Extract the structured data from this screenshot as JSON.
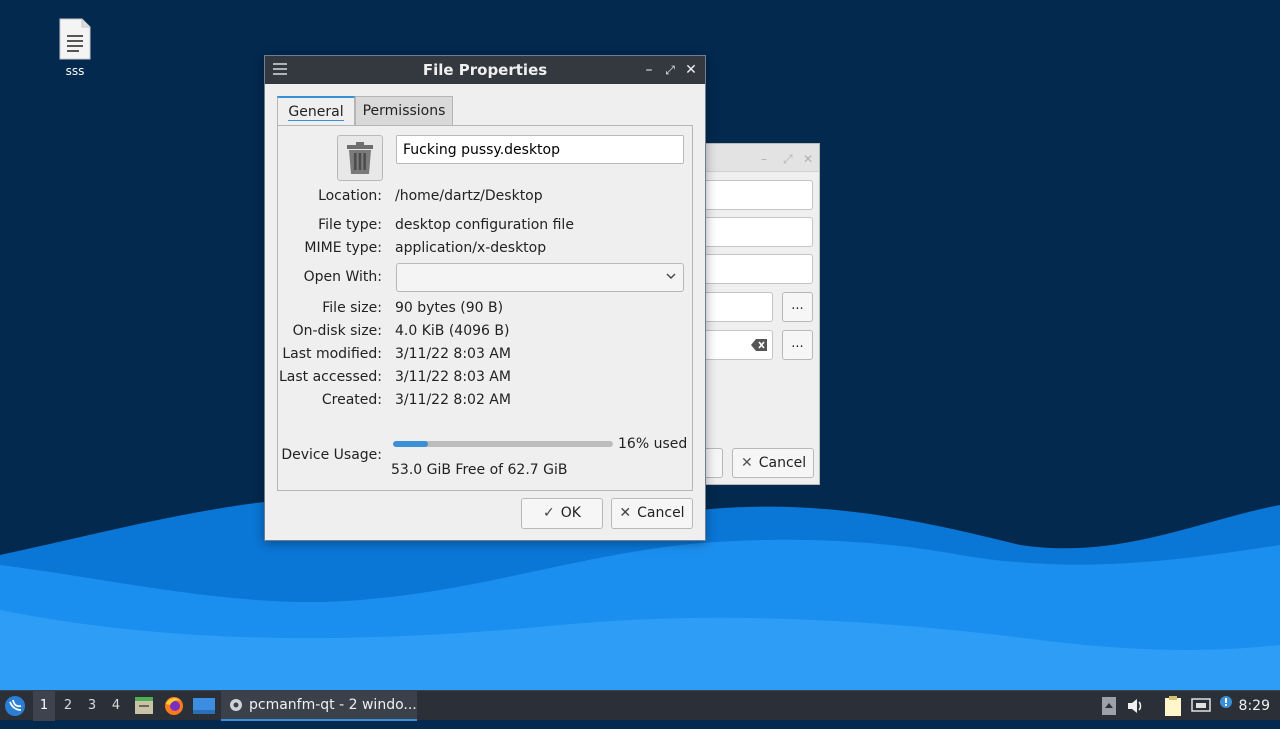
{
  "desktop": {
    "icon_label": "sss"
  },
  "background_dialog": {
    "browse_label": "...",
    "cancel_label": "Cancel"
  },
  "dialog": {
    "title": "File Properties",
    "tabs": [
      {
        "label": "General",
        "active": true
      },
      {
        "label": "Permissions",
        "active": false
      }
    ],
    "file_name": "Fucking pussy.desktop",
    "fields": {
      "location": {
        "label": "Location:",
        "value": "/home/dartz/Desktop"
      },
      "file_type": {
        "label": "File type:",
        "value": "desktop configuration file"
      },
      "mime_type": {
        "label": "MIME type:",
        "value": "application/x-desktop"
      },
      "open_with": {
        "label": "Open With:",
        "value": ""
      },
      "file_size": {
        "label": "File size:",
        "value": "90 bytes (90 B)"
      },
      "on_disk_size": {
        "label": "On-disk size:",
        "value": "4.0 KiB (4096 B)"
      },
      "last_modified": {
        "label": "Last modified:",
        "value": "3/11/22 8:03 AM"
      },
      "last_accessed": {
        "label": "Last accessed:",
        "value": "3/11/22 8:03 AM"
      },
      "created": {
        "label": "Created:",
        "value": "3/11/22 8:02 AM"
      }
    },
    "device_usage": {
      "label": "Device Usage:",
      "percent_text": "16% used",
      "used_fraction": 0.16,
      "free_text": "53.0 GiB Free of 62.7 GiB"
    },
    "ok_label": "OK",
    "cancel_label": "Cancel"
  },
  "taskbar": {
    "workspaces": [
      "1",
      "2",
      "3",
      "4"
    ],
    "active_workspace": "1",
    "task_label": "pcmanfm-qt - 2 windo...",
    "clock": "8:29"
  },
  "colors": {
    "accent": "#3b8fd6",
    "titlebar": "#33393f",
    "wallpaper_dark": "#03294f",
    "wave_light": "#2196f3"
  }
}
